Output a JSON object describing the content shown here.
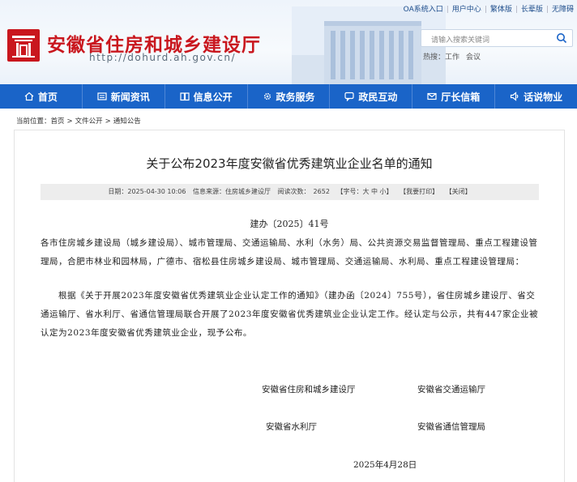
{
  "toplinks": [
    "OA系统入口",
    "用户中心",
    "繁体版",
    "长辈版",
    "无障碍"
  ],
  "site": {
    "title": "安徽省住房和城乡建设厅",
    "url": "http://dohurd.ah.gov.cn/",
    "brand_color": "#c9171e"
  },
  "search": {
    "placeholder": "请输入搜索关键词"
  },
  "hotwords": [
    "热搜：",
    "工作",
    "会议"
  ],
  "nav": [
    {
      "label": "首页",
      "icon": "home-icon"
    },
    {
      "label": "新闻资讯",
      "icon": "news-icon"
    },
    {
      "label": "信息公开",
      "icon": "book-icon"
    },
    {
      "label": "政务服务",
      "icon": "gear-icon"
    },
    {
      "label": "政民互动",
      "icon": "chat-icon"
    },
    {
      "label": "厅长信箱",
      "icon": "mail-icon"
    },
    {
      "label": "话说物业",
      "icon": "speaker-icon"
    }
  ],
  "nav_color": "#1a64c8",
  "breadcrumb": [
    "当前位置：",
    "首页",
    "文件公开",
    "通知公告"
  ],
  "article": {
    "title": "关于公布2023年度安徽省优秀建筑业企业名单的通知",
    "meta": {
      "date_label": "日期：",
      "date": "2025-04-30 10:06",
      "source_label": "信息来源：",
      "source": "住房城乡建设厅",
      "views_label": "阅读次数：",
      "views": "2652",
      "font_label": "【字号：",
      "font_options": "大 中 小】",
      "print": "【我要打印】",
      "close": "【关闭】"
    },
    "doc_no": "建办〔2025〕41号",
    "para1": "各市住房城乡建设局（城乡建设局）、城市管理局、交通运输局、水利（水务）局、公共资源交易监督管理局、重点工程建设管理局，合肥市林业和园林局，广德市、宿松县住房城乡建设局、城市管理局、交通运输局、水利局、重点工程建设管理局：",
    "para2": "根据《关于开展2023年度安徽省优秀建筑业企业认定工作的通知》（建办函〔2024〕755号），省住房城乡建设厅、省交通运输厅、省水利厅、省通信管理局联合开展了2023年度安徽省优秀建筑业企业认定工作。经认定与公示，共有447家企业被认定为2023年度安徽省优秀建筑业企业，现予公布。",
    "signatories": [
      "安徽省住房和城乡建设厅",
      "安徽省交通运输厅",
      "安徽省水利厅",
      "安徽省通信管理局"
    ],
    "date_signed": "2025年4月28日"
  }
}
